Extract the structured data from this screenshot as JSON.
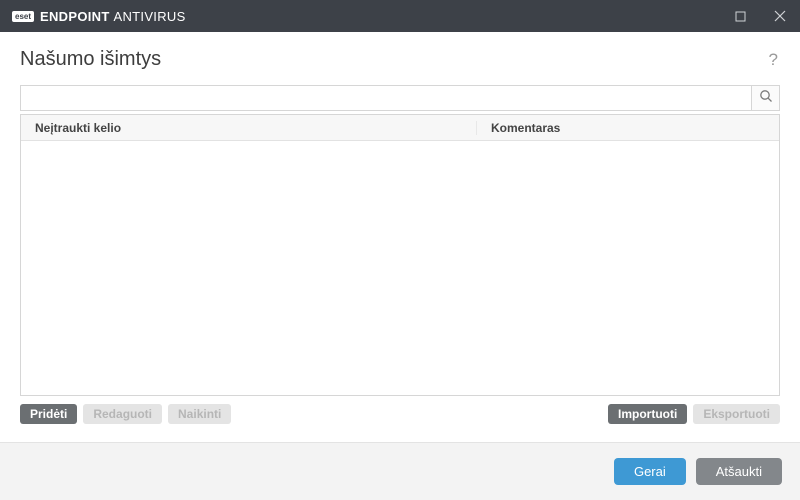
{
  "titlebar": {
    "brand_badge": "eset",
    "brand_strong": "ENDPOINT",
    "brand_light": "ANTIVIRUS"
  },
  "header": {
    "title": "Našumo išimtys",
    "help": "?"
  },
  "search": {
    "value": "",
    "placeholder": ""
  },
  "table": {
    "columns": {
      "path": "Neįtraukti kelio",
      "comment": "Komentaras"
    }
  },
  "toolbar": {
    "add": "Pridėti",
    "edit": "Redaguoti",
    "delete": "Naikinti",
    "import": "Importuoti",
    "export": "Eksportuoti"
  },
  "footer": {
    "ok": "Gerai",
    "cancel": "Atšaukti"
  }
}
